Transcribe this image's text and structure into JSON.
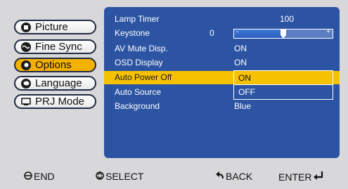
{
  "menu": {
    "items": [
      {
        "label": "Picture",
        "icon": "picture-icon"
      },
      {
        "label": "Fine Sync",
        "icon": "fine-sync-icon"
      },
      {
        "label": "Options",
        "icon": "options-icon",
        "active": true
      },
      {
        "label": "Language",
        "icon": "language-icon"
      },
      {
        "label": "PRJ Mode",
        "icon": "prj-mode-icon"
      }
    ]
  },
  "options": {
    "lamp_timer": {
      "label": "Lamp Timer",
      "value": "100"
    },
    "keystone": {
      "label": "Keystone",
      "value": "0",
      "minus": "-",
      "plus": "+",
      "level": 0.5
    },
    "av_mute": {
      "label": "AV Mute Disp.",
      "value": "ON"
    },
    "osd_display": {
      "label": "OSD Display",
      "value": "ON"
    },
    "auto_power_off": {
      "label": "Auto Power Off",
      "options": [
        "ON",
        "OFF"
      ],
      "selected": "ON"
    },
    "auto_source": {
      "label": "Auto Source"
    },
    "background": {
      "label": "Background",
      "value": "Blue"
    }
  },
  "hints": {
    "end": "END",
    "select": "SELECT",
    "back": "BACK",
    "enter": "ENTER"
  },
  "colors": {
    "panel": "#2c54a3",
    "highlight": "#f6c200",
    "frame": "#d8d8da"
  }
}
